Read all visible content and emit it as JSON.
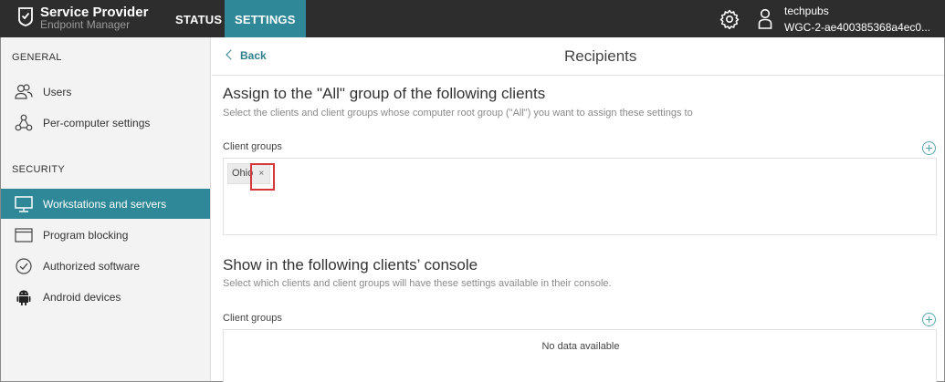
{
  "app": {
    "title": "Service Provider",
    "subtitle": "Endpoint Manager"
  },
  "nav": {
    "tabs": [
      {
        "label": "STATUS",
        "active": false
      },
      {
        "label": "SETTINGS",
        "active": true
      }
    ]
  },
  "user": {
    "name": "techpubs",
    "id": "WGC-2-ae400385368a4ec0..."
  },
  "sidebar": {
    "general_title": "GENERAL",
    "general_items": [
      {
        "label": "Users",
        "icon": "users-icon"
      },
      {
        "label": "Per-computer settings",
        "icon": "network-icon"
      }
    ],
    "security_title": "SECURITY",
    "security_items": [
      {
        "label": "Workstations and servers",
        "icon": "monitor-icon",
        "active": true
      },
      {
        "label": "Program blocking",
        "icon": "window-icon"
      },
      {
        "label": "Authorized software",
        "icon": "check-circle-icon"
      },
      {
        "label": "Android devices",
        "icon": "android-icon"
      }
    ]
  },
  "main": {
    "back_label": "Back",
    "title": "Recipients",
    "section1": {
      "heading": "Assign to the \"All\" group of the following clients",
      "description": "Select the clients and client groups whose computer root group (\"All\") you want to assign these settings to",
      "field_label": "Client groups",
      "chips": [
        {
          "label": "Ohio",
          "remove": "×"
        }
      ]
    },
    "section2": {
      "heading": "Show in the following clients’ console",
      "description": "Select which clients and client groups will have these settings available in their console.",
      "field_label": "Client groups",
      "empty_text": "No data available"
    }
  },
  "colors": {
    "accent": "#2f8897",
    "topbar": "#2d2d2d",
    "highlight": "#d6353a"
  }
}
